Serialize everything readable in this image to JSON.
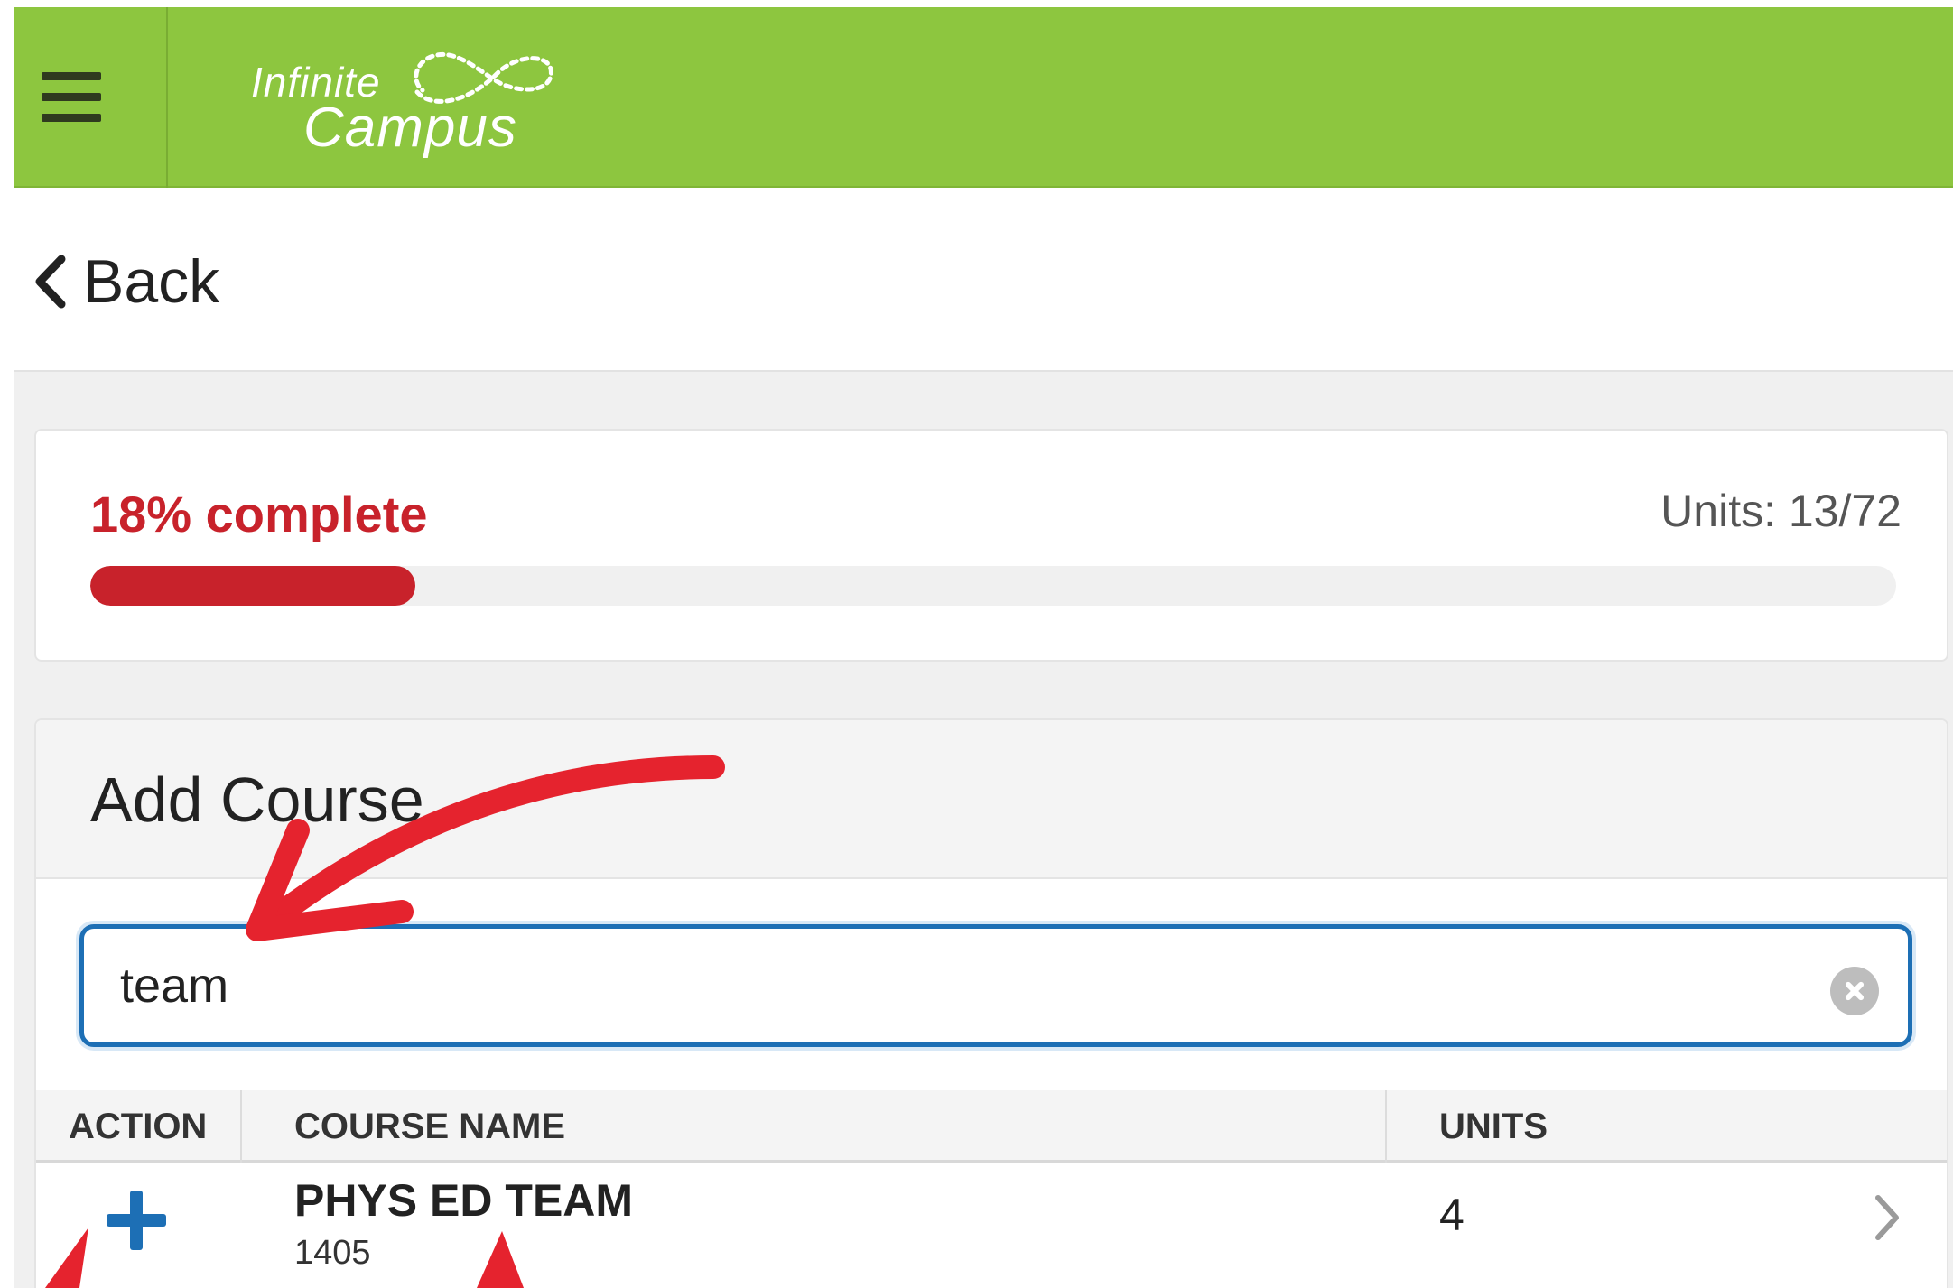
{
  "header": {
    "logo_top": "Infinite",
    "logo_bottom": "Campus"
  },
  "nav": {
    "back_label": "Back"
  },
  "progress": {
    "label": "18% complete",
    "units_label": "Units: 13/72",
    "percent": 18
  },
  "add_course": {
    "title": "Add Course",
    "search_value": "team",
    "columns": {
      "action": "ACTION",
      "course_name": "COURSE NAME",
      "units": "UNITS"
    },
    "rows": [
      {
        "name": "PHYS ED TEAM",
        "number": "1405",
        "units": "4"
      }
    ]
  },
  "colors": {
    "header_green": "#8dc63f",
    "progress_red": "#c8222b",
    "accent_blue": "#1d6fb5",
    "annotation_red": "#e5232e"
  }
}
